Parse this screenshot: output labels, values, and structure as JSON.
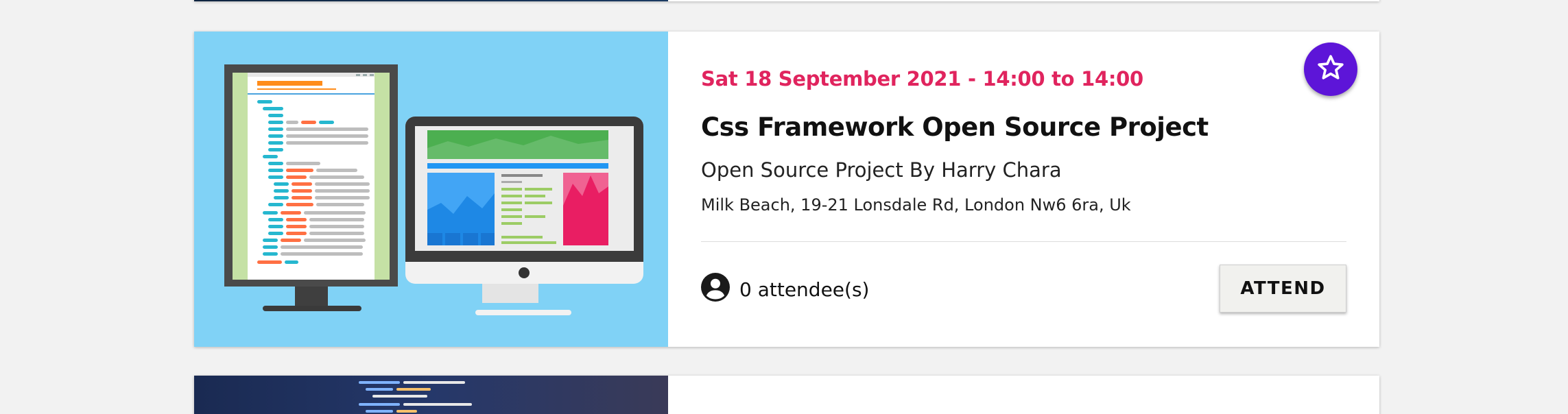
{
  "event": {
    "date_time": "Sat 18 September 2021 - 14:00 to 14:00",
    "title": "Css Framework Open Source Project",
    "subtitle": "Open Source Project By Harry Chara",
    "location": "Milk Beach, 19-21 Lonsdale Rd, London Nw6 6ra, Uk",
    "attendees_label": "0 attendee(s)",
    "attend_button": "ATTEND",
    "favorite_icon": "star-outline-icon",
    "attendee_icon": "account-circle-icon",
    "image": "computer-monitors-illustration"
  },
  "colors": {
    "date": "#e0245e",
    "favorite_button": "#5d15d8",
    "image_background": "#80d2f6"
  }
}
